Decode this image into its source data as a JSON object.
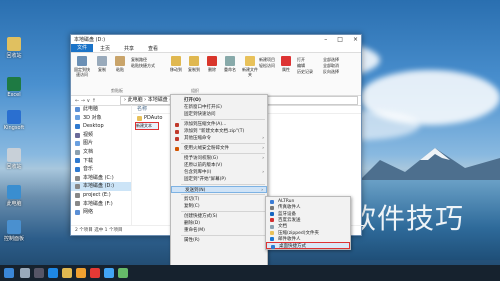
{
  "window": {
    "title": "本地磁盘 (D:)",
    "tabs": [
      "文件",
      "主页",
      "共享",
      "查看"
    ],
    "ribbon": {
      "pin": "固定到快速访问",
      "copy": "复制",
      "paste": "粘贴",
      "copy_path": "复制路径",
      "paste_shortcut": "粘贴快捷方式",
      "move_to": "移动到",
      "copy_to": "复制到",
      "delete": "删除",
      "rename": "重命名",
      "new_folder": "新建文件夹",
      "new_item": "新建项目",
      "easy_access": "轻松访问",
      "properties": "属性",
      "open": "打开",
      "edit": "编辑",
      "history": "历史记录",
      "select_all": "全部选择",
      "select_none": "全部取消",
      "invert": "反向选择",
      "group_clipboard": "剪贴板",
      "group_organize": "组织"
    },
    "address": {
      "path": "› 此电脑 › 本地磁盘 (D:)",
      "nav": "← → ∨ ↑"
    },
    "nav_pane": [
      {
        "label": "此电脑",
        "color": "#5a8fd6"
      },
      {
        "label": "3D 对象",
        "color": "#6aa0e0"
      },
      {
        "label": "Desktop",
        "color": "#2f7ad0"
      },
      {
        "label": "视频",
        "color": "#6a6a9a"
      },
      {
        "label": "图片",
        "color": "#6aa0e0"
      },
      {
        "label": "文档",
        "color": "#8aa0b0"
      },
      {
        "label": "下载",
        "color": "#2f7ad0"
      },
      {
        "label": "音乐",
        "color": "#2f7ad0"
      },
      {
        "label": "本地磁盘 (C:)",
        "color": "#888"
      },
      {
        "label": "本地磁盘 (D:)",
        "color": "#888"
      },
      {
        "label": "project (E:)",
        "color": "#888"
      },
      {
        "label": "本地磁盘 (F:)",
        "color": "#888"
      },
      {
        "label": "网络",
        "color": "#5a8fd6"
      }
    ],
    "content": {
      "column_name": "名称",
      "folder": "PDAuto",
      "new_file": "新建文本"
    },
    "status": "2 个项目   选中 1 个项目"
  },
  "context_menu": [
    {
      "label": "打开(O)",
      "bold": true
    },
    {
      "label": "在新窗口中打开(E)"
    },
    {
      "label": "固定到快速访问"
    },
    {
      "sep": true
    },
    {
      "label": "添加到压缩文件(A)...",
      "icon": "#c0392b"
    },
    {
      "label": "添加到 \"新建文本文档.zip\"(T)",
      "icon": "#c0392b"
    },
    {
      "label": "其他压缩命令",
      "icon": "#c0392b",
      "arrow": true
    },
    {
      "sep": true
    },
    {
      "label": "使用火绒安全粉碎文件",
      "icon": "#d35400",
      "arrow": true
    },
    {
      "sep": true
    },
    {
      "label": "授予访问权限(G)",
      "arrow": true
    },
    {
      "label": "还原以前的版本(V)"
    },
    {
      "label": "包含到库中(I)",
      "arrow": true
    },
    {
      "label": "固定到\"开始\"屏幕(P)"
    },
    {
      "sep": true
    },
    {
      "label": "发送到(N)",
      "arrow": true,
      "highlight": true
    },
    {
      "sep": true
    },
    {
      "label": "剪切(T)"
    },
    {
      "label": "复制(C)"
    },
    {
      "sep": true
    },
    {
      "label": "创建快捷方式(S)"
    },
    {
      "label": "删除(D)"
    },
    {
      "label": "重命名(M)"
    },
    {
      "sep": true
    },
    {
      "label": "属性(R)"
    }
  ],
  "submenu": [
    {
      "label": "ALTRun",
      "icon": "#3a7bd5"
    },
    {
      "label": "传真收件人",
      "icon": "#777"
    },
    {
      "label": "蓝牙设备",
      "icon": "#1565c0"
    },
    {
      "label": "百度云发送",
      "icon": "#d32f2f"
    },
    {
      "label": "文档",
      "icon": "#8aa0b0"
    },
    {
      "label": "压缩(zipped)文件夹",
      "icon": "#e8c15a"
    },
    {
      "label": "邮件收件人",
      "icon": "#1976d2"
    },
    {
      "label": "桌面快捷方式",
      "icon": "#2f7ad0",
      "highlight": true
    }
  ],
  "desktop_icons": [
    {
      "label": "回收站",
      "color": "#e0c060"
    },
    {
      "label": "Excel",
      "color": "#1e7a43"
    },
    {
      "label": "Kingsoft",
      "color": "#2a6fd0"
    },
    {
      "label": "回收站",
      "color": "#c8d0d8"
    },
    {
      "label": "此电脑",
      "color": "#3a8ed0"
    },
    {
      "label": "控制面板",
      "color": "#4a90cf"
    }
  ],
  "watermark": "软件技巧"
}
